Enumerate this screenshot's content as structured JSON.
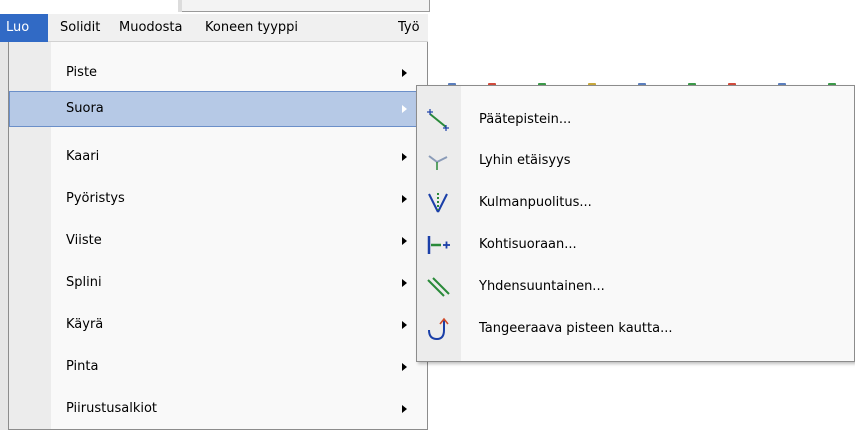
{
  "menubar": {
    "items": [
      {
        "label": "Luo"
      },
      {
        "label": "Solidit"
      },
      {
        "label": "Muodosta"
      },
      {
        "label": "Koneen tyyppi"
      },
      {
        "label": "Työ"
      }
    ]
  },
  "main_menu": {
    "items": [
      {
        "label": "Piste"
      },
      {
        "label": "Suora"
      },
      {
        "label": "Kaari"
      },
      {
        "label": "Pyöristys"
      },
      {
        "label": "Viiste"
      },
      {
        "label": "Splini"
      },
      {
        "label": "Käyrä"
      },
      {
        "label": "Pinta"
      },
      {
        "label": "Piirustusalkiot"
      }
    ]
  },
  "sub_menu": {
    "items": [
      {
        "label": "Päätepistein...",
        "icon": "endpoints-line-icon"
      },
      {
        "label": "Lyhin etäisyys",
        "icon": "shortest-distance-icon"
      },
      {
        "label": "Kulmanpuolitus...",
        "icon": "angle-bisector-icon"
      },
      {
        "label": "Kohtisuoraan...",
        "icon": "perpendicular-line-icon"
      },
      {
        "label": "Yhdensuuntainen...",
        "icon": "parallel-line-icon"
      },
      {
        "label": "Tangeeraava pisteen kautta...",
        "icon": "tangent-through-point-icon"
      }
    ]
  },
  "colors": {
    "menubar_active_bg": "#316ac5",
    "highlight_bg": "#b6c9e6",
    "highlight_border": "#6b8fc9"
  }
}
